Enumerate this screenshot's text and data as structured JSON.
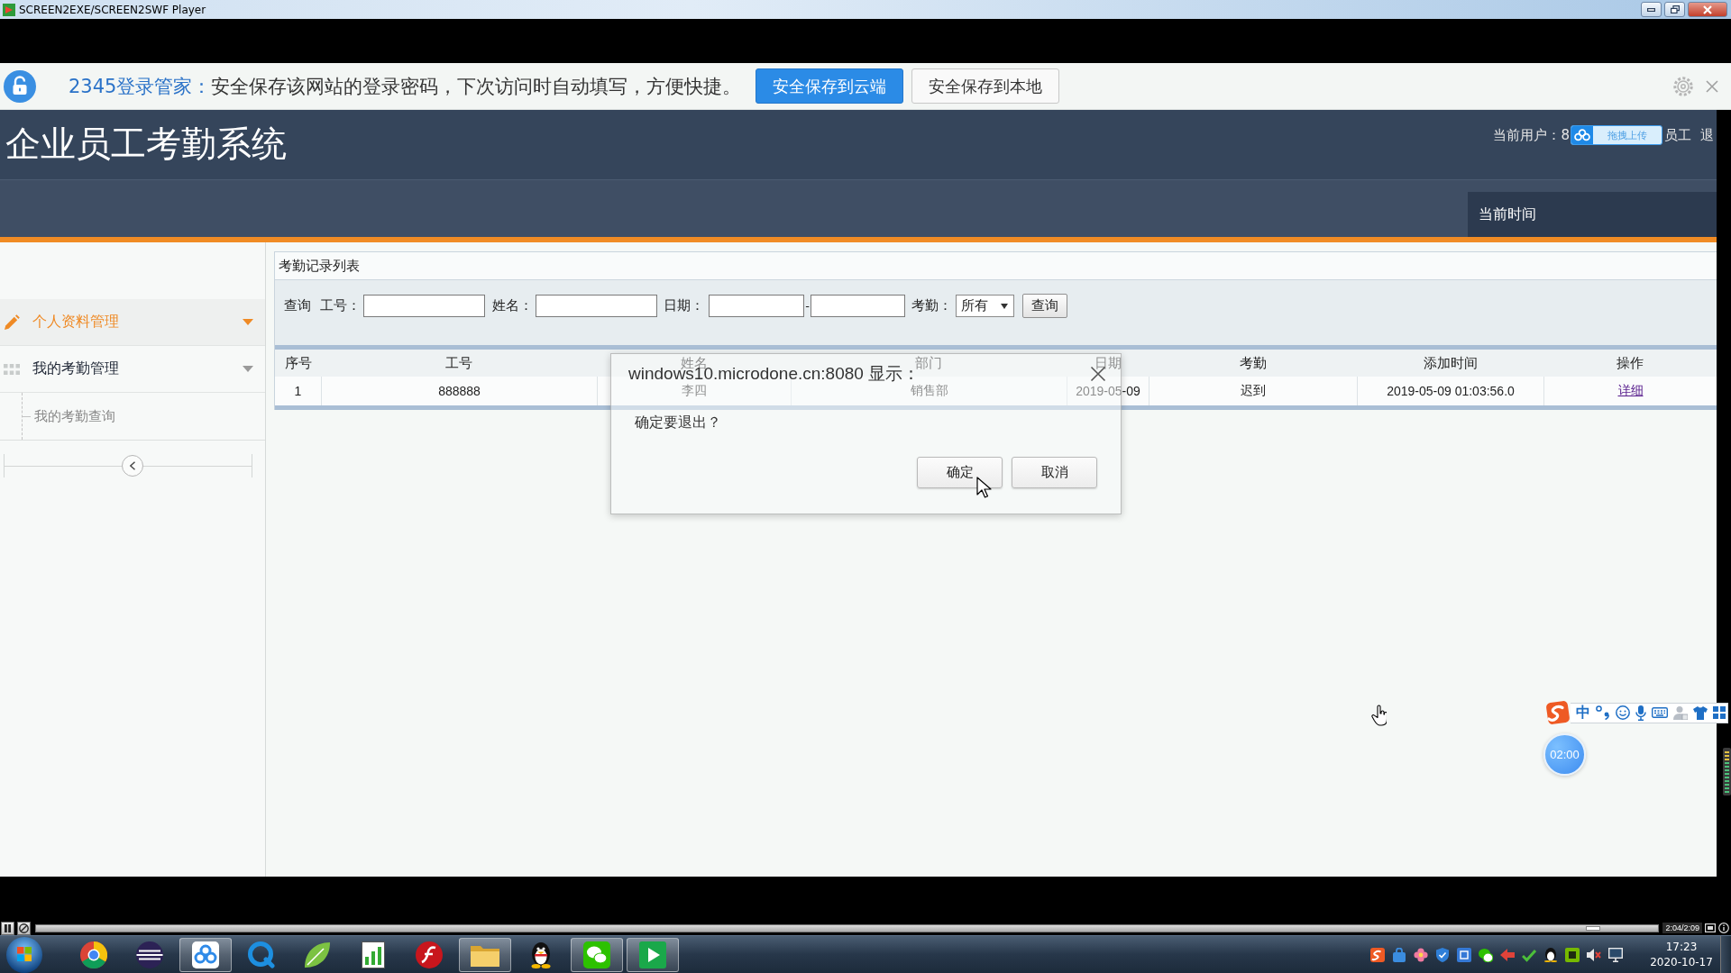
{
  "player_window": {
    "title": "SCREEN2EXE/SCREEN2SWF Player"
  },
  "password_bar": {
    "brand": "2345登录管家：",
    "message": "安全保存该网站的登录密码，下次访问时自动填写，方便快捷。",
    "buttons": [
      {
        "label": "安全保存到云端",
        "primary": true
      },
      {
        "label": "安全保存到本地",
        "primary": false
      }
    ]
  },
  "header": {
    "title": "企业员工考勤系统",
    "user": "当前用户：8",
    "upload_widget": "拖拽上传",
    "role": "员工",
    "logout": "退",
    "clock_label": "当前时间"
  },
  "sidebar": {
    "items": [
      {
        "label": "个人资料管理",
        "kind": "pencil",
        "selected": true
      },
      {
        "label": "我的考勤管理",
        "kind": "grid",
        "selected": false,
        "children": [
          {
            "label": "我的考勤查询",
            "selected": false
          }
        ]
      }
    ]
  },
  "records_panel": {
    "title": "考勤记录列表",
    "query": {
      "label": "查询",
      "fields": [
        {
          "label": "工号：",
          "kind": "text"
        },
        {
          "label": "姓名：",
          "kind": "text"
        },
        {
          "label": "日期：",
          "kind": "range",
          "separator": "-"
        },
        {
          "label": "考勤：",
          "kind": "select",
          "value": "所有"
        }
      ],
      "button": "查询"
    },
    "table": {
      "columns": [
        {
          "label": "序号",
          "kind": "text"
        },
        {
          "label": "工号",
          "kind": "text"
        },
        {
          "label": "姓名",
          "kind": "text"
        },
        {
          "label": "部门",
          "kind": "text"
        },
        {
          "label": "日期",
          "kind": "text"
        },
        {
          "label": "考勤",
          "kind": "text"
        },
        {
          "label": "添加时间",
          "kind": "text"
        },
        {
          "label": "操作",
          "kind": "link"
        }
      ],
      "rows": [
        [
          "1",
          "888888",
          "李四",
          "销售部",
          "2019-05-09",
          "迟到",
          "2019-05-09 01:03:56.0",
          "详细"
        ]
      ]
    }
  },
  "dialog": {
    "title": "windows10.microdone.cn:8080 显示：",
    "message": "确定要退出？",
    "buttons": [
      "确定",
      "取消"
    ]
  },
  "ime_toolbar": {
    "mode": "中"
  },
  "timer": {
    "text": "02:00"
  },
  "player_controls": {
    "level": 0.96,
    "time": "2:04/2:09"
  },
  "taskbar": {
    "apps": [
      {
        "kind": "browser",
        "open": false
      },
      {
        "kind": "sphere",
        "open": false
      },
      {
        "kind": "cloud",
        "open": true
      },
      {
        "kind": "bubble",
        "open": false
      },
      {
        "kind": "leaf",
        "open": false
      },
      {
        "kind": "chart",
        "open": false
      },
      {
        "kind": "swirl",
        "open": false
      },
      {
        "kind": "folder",
        "open": true
      },
      {
        "kind": "penguin",
        "open": false
      },
      {
        "kind": "chat",
        "open": true
      },
      {
        "kind": "play",
        "open": true
      }
    ],
    "time": "17:23",
    "date": "2020-10-17"
  }
}
